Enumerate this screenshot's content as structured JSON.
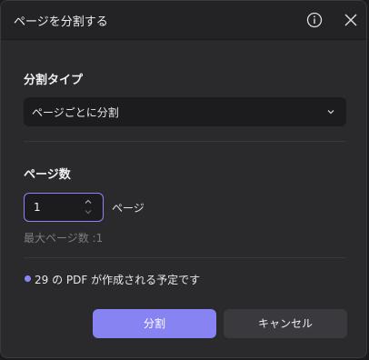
{
  "dialog": {
    "title": "ページを分割する",
    "info_icon": "info-icon",
    "close_icon": "close-icon"
  },
  "split_type": {
    "label": "分割タイプ",
    "selected": "ページごとに分割",
    "chevron_icon": "chevron-down-icon"
  },
  "page_count": {
    "label": "ページ数",
    "value": "1",
    "unit": "ページ",
    "max_label": "最大ページ数 :1"
  },
  "result_info": {
    "text": "29 の PDF が作成される予定です"
  },
  "buttons": {
    "split": "分割",
    "cancel": "キャンセル"
  },
  "colors": {
    "accent": "#8883f3",
    "background": "#2a2a2d",
    "input_bg": "#1c1c1e",
    "secondary_button": "#3a3a3e"
  }
}
